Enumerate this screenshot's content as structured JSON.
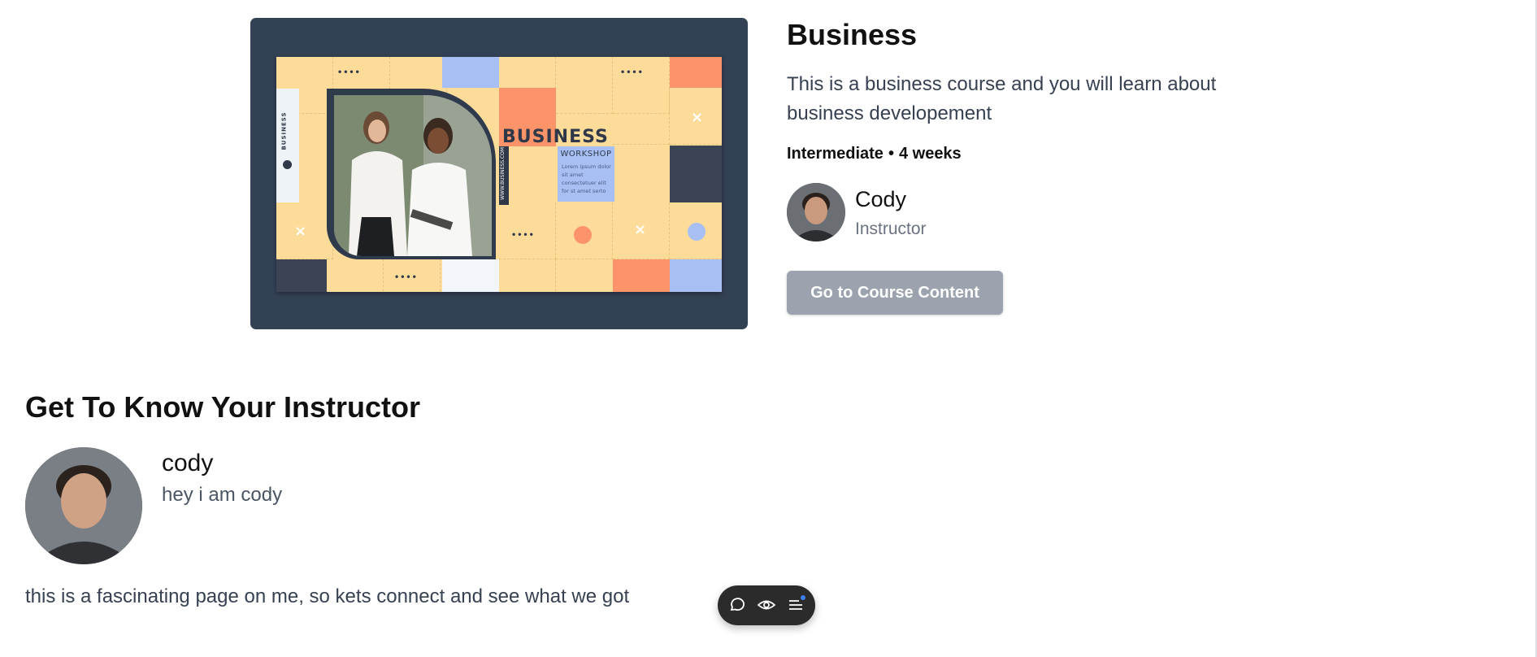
{
  "course": {
    "title": "Business",
    "description": "This is a business course and you will learn about business developement",
    "level": "Intermediate",
    "separator": "•",
    "duration": "4 weeks",
    "instructor_name": "Cody",
    "instructor_role": "Instructor",
    "cta_label": "Go to Course Content",
    "thumbnail": {
      "heading": "BUSINESS",
      "badge": "WORKSHOP",
      "badge_text": "Lorem ipsum dolor sit amet consectetuer elit for st amet serto",
      "side_url": "WWW.BUSINESS.COM",
      "side_brand": "BUSINESS"
    }
  },
  "instructor_section": {
    "heading": "Get To Know Your Instructor",
    "name": "cody",
    "tagline": "hey i am cody",
    "bio": "this is a fascinating page on me, so kets connect and see what we got"
  },
  "toolbar": {
    "items": [
      "comment-icon",
      "eye-icon",
      "menu-icon"
    ],
    "notification_color": "#3b82f6"
  },
  "colors": {
    "thumb_frame": "#334155",
    "button_disabled": "#9ca3af",
    "banner_yellow": "#fddc9a",
    "banner_orange": "#fd9469",
    "banner_blue": "#a7bff3",
    "banner_navy": "#3a4454"
  }
}
